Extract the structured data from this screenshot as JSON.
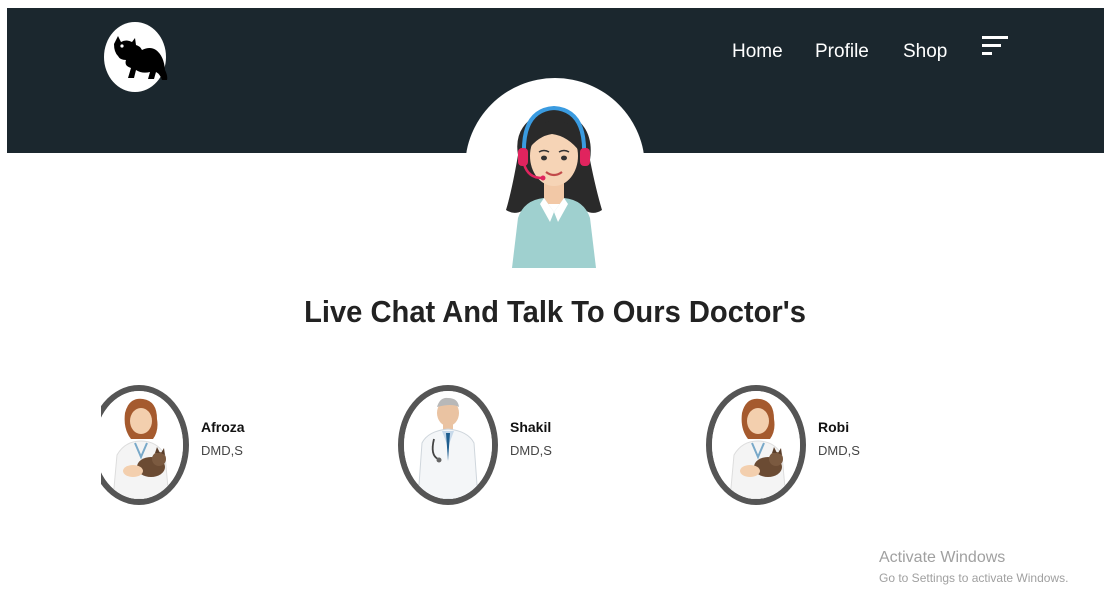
{
  "nav": {
    "items": [
      "Home",
      "Profile",
      "Shop"
    ]
  },
  "icons": {
    "logo": "cat-logo-icon",
    "menu": "menu-lines-icon",
    "agent": "support-agent-illustration"
  },
  "colors": {
    "header_bg": "#1b272e",
    "ring": "#555555"
  },
  "hero": {
    "headline": "Live Chat And Talk To Ours Doctor's"
  },
  "doctors": [
    {
      "name": "Afroza",
      "title": "DMD,S"
    },
    {
      "name": "Shakil",
      "title": "DMD,S"
    },
    {
      "name": "Robi",
      "title": "DMD,S"
    }
  ],
  "watermark": {
    "line1": "Activate Windows",
    "line2": "Go to Settings to activate Windows."
  }
}
